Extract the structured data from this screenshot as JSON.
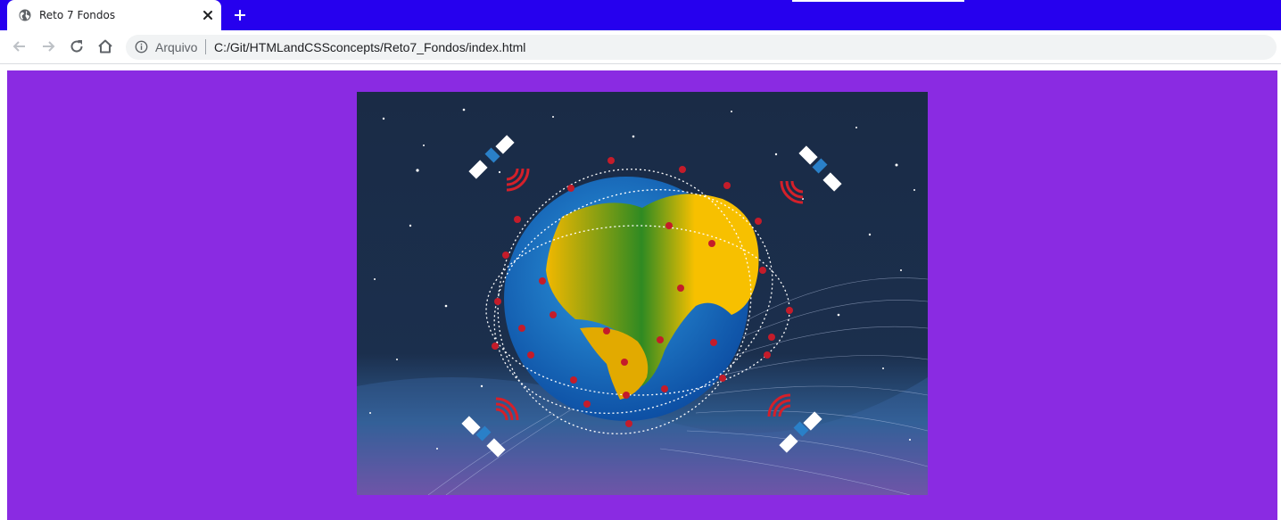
{
  "browser": {
    "tab_title": "Reto 7 Fondos",
    "address_label": "Arquivo",
    "address_url": "C:/Git/HTMLandCSSconcepts/Reto7_Fondos/index.html"
  },
  "colors": {
    "tabbar": "#2600ee",
    "page_background": "#8a2be2",
    "image_sky": "#1a2b46"
  },
  "icons": [
    "globe-icon",
    "close-icon",
    "plus-icon",
    "back-icon",
    "forward-icon",
    "reload-icon",
    "home-icon",
    "info-icon"
  ]
}
